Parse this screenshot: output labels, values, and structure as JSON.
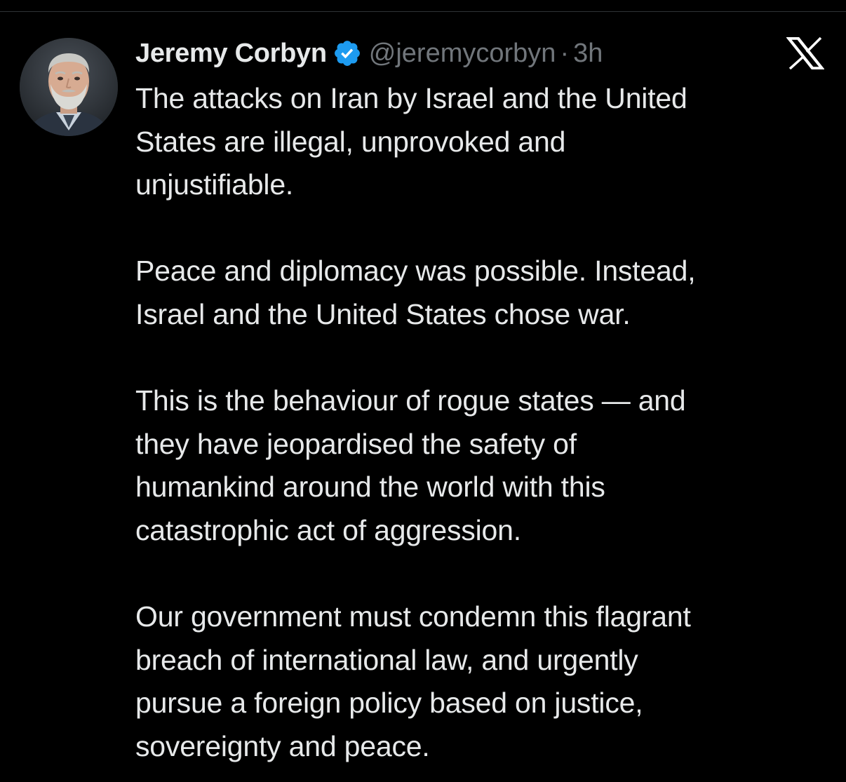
{
  "tweet": {
    "author_name": "Jeremy Corbyn",
    "handle": "@jeremycorbyn",
    "separator": "·",
    "time_ago": "3h",
    "verified_color": "#1d9bf0",
    "avatar_icon": "profile-photo",
    "platform_icon": "x-logo-icon",
    "paragraphs": [
      {
        "lines": [
          "The attacks on Iran by Israel and the United",
          "States are illegal, unprovoked and",
          "unjustifiable."
        ]
      },
      {
        "lines": [
          "Peace and diplomacy was possible. Instead,",
          "Israel and the United States chose war."
        ]
      },
      {
        "lines": [
          "This is the behaviour of rogue states — and",
          "they have jeopardised the safety of",
          "humankind around the world with this",
          "catastrophic act of aggression."
        ]
      },
      {
        "lines": [
          "Our government must condemn this flagrant",
          "breach of international law, and urgently",
          "pursue a foreign policy based on justice,",
          "sovereignty and peace."
        ]
      }
    ]
  },
  "colors": {
    "background": "#000000",
    "text_primary": "#e7e9ea",
    "text_secondary": "#71767b",
    "divider": "#2f3336",
    "accent": "#1d9bf0"
  }
}
